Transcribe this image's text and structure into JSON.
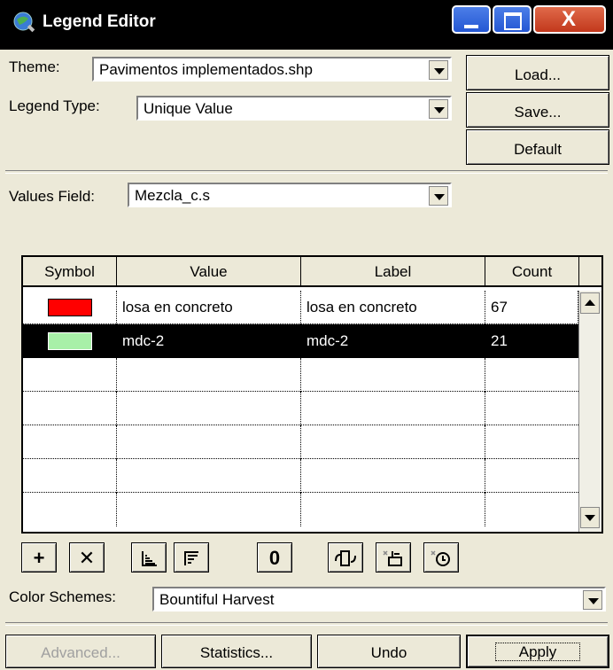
{
  "window": {
    "title": "Legend Editor"
  },
  "theme": {
    "label": "Theme:",
    "value": "Pavimentos implementados.shp"
  },
  "legend_type": {
    "label": "Legend Type:",
    "value": "Unique Value"
  },
  "side_buttons": {
    "load": "Load...",
    "save": "Save...",
    "default": "Default"
  },
  "values_field": {
    "label": "Values Field:",
    "value": "Mezcla_c.s"
  },
  "table": {
    "headers": [
      "Symbol",
      "Value",
      "Label",
      "Count"
    ],
    "rows": [
      {
        "color": "#ff0000",
        "value": "losa en concreto",
        "label": "losa en concreto",
        "count": "67"
      },
      {
        "color": "#a8f0a8",
        "value": "mdc-2",
        "label": "mdc-2",
        "count": "21"
      }
    ]
  },
  "tools": {
    "add_icon": "+",
    "delete_icon": "✕",
    "zero_label": "0"
  },
  "color_schemes": {
    "label": "Color Schemes:",
    "value": "Bountiful Harvest"
  },
  "bottom_buttons": {
    "advanced": "Advanced...",
    "statistics": "Statistics...",
    "undo": "Undo",
    "apply": "Apply"
  }
}
